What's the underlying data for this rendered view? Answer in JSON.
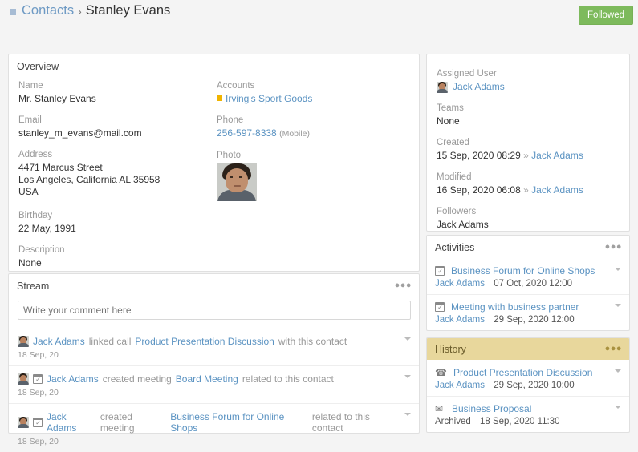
{
  "header": {
    "breadcrumb_parent": "Contacts",
    "breadcrumb_separator": "›",
    "breadcrumb_current": "Stanley Evans",
    "followed_label": "Followed",
    "followed_color": "#7dba5c"
  },
  "overview": {
    "title": "Overview",
    "left_fields": [
      {
        "label": "Name",
        "value": "Mr. Stanley Evans"
      },
      {
        "label": "Email",
        "value": "stanley_m_evans@mail.com"
      },
      {
        "label": "Address",
        "value": "4471 Marcus Street\nLos Angeles, California AL 35958\nUSA"
      },
      {
        "label": "Birthday",
        "value": "22 May, 1991"
      },
      {
        "label": "Description",
        "value": "None"
      }
    ],
    "right_fields": [
      {
        "label": "Accounts",
        "value": "Irving's Sport Goods"
      },
      {
        "label": "Phone",
        "value": "256-597-8338",
        "suffix": "(Mobile)"
      },
      {
        "label": "Photo",
        "value": ""
      }
    ],
    "account_bullet_color": "#f0b400"
  },
  "stream": {
    "title": "Stream",
    "comment_placeholder": "Write your comment here",
    "items": [
      {
        "author": "Jack Adams",
        "action": "linked call",
        "subject": "Product Presentation Discussion",
        "tail": "with this contact",
        "date": "18 Sep, 20",
        "icon": "none"
      },
      {
        "author": "Jack Adams",
        "action": "created meeting",
        "subject": "Board Meeting",
        "tail": "related to this contact",
        "date": "18 Sep, 20",
        "icon": "calendar-icon"
      },
      {
        "author": "Jack Adams",
        "action": "created meeting",
        "subject": "Business Forum for Online Shops",
        "tail": "related to this contact",
        "date": "18 Sep, 20",
        "icon": "calendar-icon"
      }
    ]
  },
  "side": {
    "fields": [
      {
        "label": "Assigned User",
        "value": "Jack Adams",
        "type": "user"
      },
      {
        "label": "Teams",
        "value": "None",
        "type": "plain"
      },
      {
        "label": "Created",
        "value": "15 Sep, 2020 08:29",
        "sep": "»",
        "by": "Jack Adams",
        "type": "stamp"
      },
      {
        "label": "Modified",
        "value": "16 Sep, 2020 06:08",
        "sep": "»",
        "by": "Jack Adams",
        "type": "stamp"
      },
      {
        "label": "Followers",
        "value": "Jack Adams",
        "type": "link"
      }
    ]
  },
  "activities": {
    "title": "Activities",
    "items": [
      {
        "icon": "calendar-icon",
        "name": "Business Forum for Online Shops",
        "who": "Jack Adams",
        "when": "07 Oct, 2020 12:00"
      },
      {
        "icon": "calendar-icon",
        "name": "Meeting with business partner",
        "who": "Jack Adams",
        "when": "29 Sep, 2020 12:00"
      }
    ]
  },
  "history": {
    "title": "History",
    "header_color": "#e8d79c",
    "items": [
      {
        "icon": "phone-icon",
        "name": "Product Presentation Discussion",
        "who": "Jack Adams",
        "when": "29 Sep, 2020 10:00"
      },
      {
        "icon": "envelope-icon",
        "name": "Business Proposal",
        "who": "Archived",
        "when": "18 Sep, 2020 11:30"
      }
    ]
  }
}
